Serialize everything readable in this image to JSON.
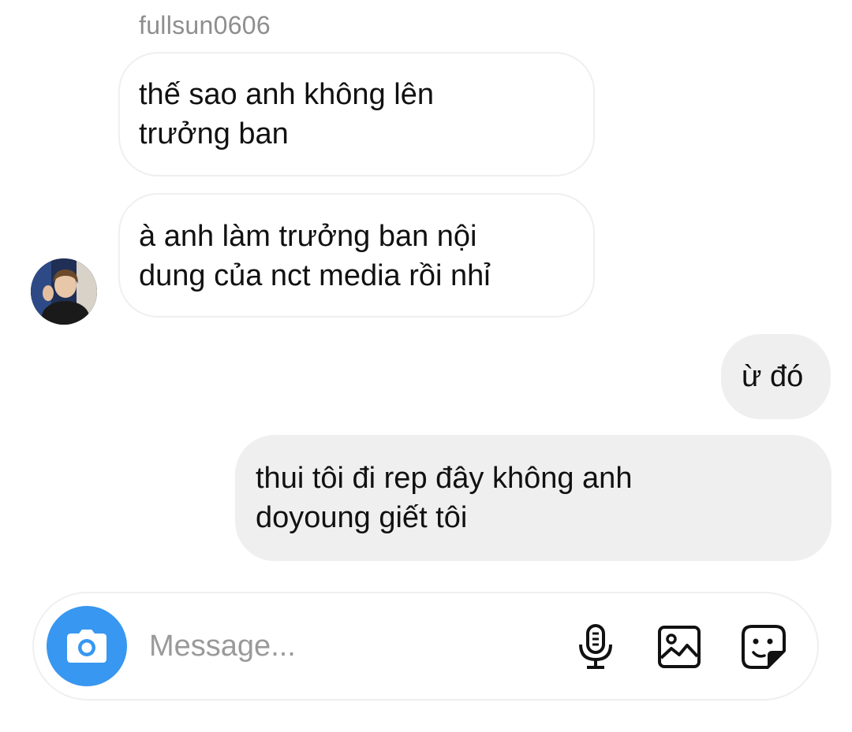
{
  "thread": {
    "sender_username": "fullsun0606",
    "messages": [
      {
        "direction": "incoming",
        "lines": [
          "thế sao anh không lên",
          "trưởng ban"
        ]
      },
      {
        "direction": "incoming",
        "lines": [
          "à anh làm trưởng ban nội",
          "dung của nct media rồi nhỉ"
        ]
      },
      {
        "direction": "outgoing",
        "lines": [
          "ừ đó"
        ]
      },
      {
        "direction": "outgoing",
        "lines": [
          "thui tôi đi rep đây không anh",
          "doyoung giết tôi"
        ]
      }
    ]
  },
  "composer": {
    "placeholder": "Message...",
    "value": "",
    "icons": [
      "camera-icon",
      "microphone-icon",
      "gallery-icon",
      "sticker-icon"
    ]
  },
  "colors": {
    "accent": "#3897f0",
    "outgoing_bubble": "#efefef",
    "incoming_border": "#efefef",
    "username": "#8e8e8e",
    "placeholder": "#9a9a9a"
  }
}
